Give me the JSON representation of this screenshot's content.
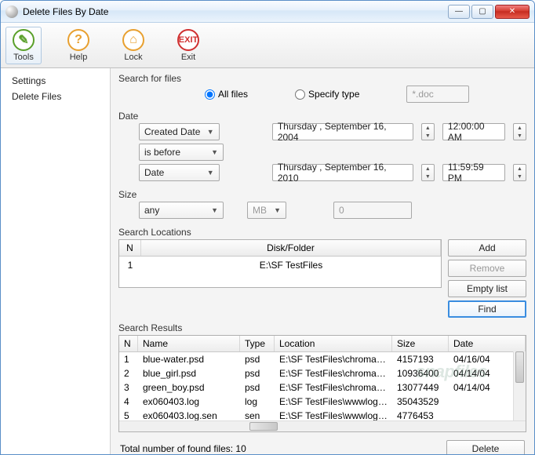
{
  "window": {
    "title": "Delete Files By Date"
  },
  "toolbar": {
    "tools": "Tools",
    "help": "Help",
    "lock": "Lock",
    "exit": "Exit",
    "exit_glyph": "EXIT"
  },
  "sidebar": {
    "items": [
      {
        "label": "Settings"
      },
      {
        "label": "Delete Files"
      }
    ]
  },
  "search_for_files": {
    "label": "Search for files",
    "all_files": "All files",
    "specify_type": "Specify type",
    "type_value": "*.doc",
    "selected": "all"
  },
  "date": {
    "label": "Date",
    "field_select": "Created Date",
    "compare_select": "is before",
    "mode_select": "Date",
    "date1": "Thursday , September 16, 2004",
    "time1": "12:00:00 AM",
    "date2": "Thursday , September 16, 2010",
    "time2": "11:59:59 PM"
  },
  "size": {
    "label": "Size",
    "mode": "any",
    "unit": "MB",
    "value": "0"
  },
  "locations": {
    "label": "Search Locations",
    "headers": {
      "n": "N",
      "path": "Disk/Folder"
    },
    "rows": [
      {
        "n": "1",
        "path": "E:\\SF TestFiles"
      }
    ],
    "buttons": {
      "add": "Add",
      "remove": "Remove",
      "empty": "Empty list",
      "find": "Find"
    }
  },
  "results": {
    "label": "Search Results",
    "headers": {
      "n": "N",
      "name": "Name",
      "type": "Type",
      "location": "Location",
      "size": "Size",
      "date": "Date"
    },
    "rows": [
      {
        "n": "1",
        "name": "blue-water.psd",
        "type": "psd",
        "location": "E:\\SF TestFiles\\chroma-sa...",
        "size": "4157193",
        "date": "04/16/04"
      },
      {
        "n": "2",
        "name": "blue_girl.psd",
        "type": "psd",
        "location": "E:\\SF TestFiles\\chroma-sa...",
        "size": "10936400",
        "date": "04/14/04"
      },
      {
        "n": "3",
        "name": "green_boy.psd",
        "type": "psd",
        "location": "E:\\SF TestFiles\\chroma-sa...",
        "size": "13077449",
        "date": "04/14/04"
      },
      {
        "n": "4",
        "name": "ex060403.log",
        "type": "log",
        "location": "E:\\SF TestFiles\\wwwlogfiles\\",
        "size": "35043529",
        "date": ""
      },
      {
        "n": "5",
        "name": "ex060403.log.sen",
        "type": "sen",
        "location": "E:\\SF TestFiles\\wwwlogfiles\\",
        "size": "4776453",
        "date": ""
      }
    ]
  },
  "footer": {
    "total_label": "Total number of found files: 10",
    "delete": "Delete"
  },
  "watermark": "snapfiles"
}
